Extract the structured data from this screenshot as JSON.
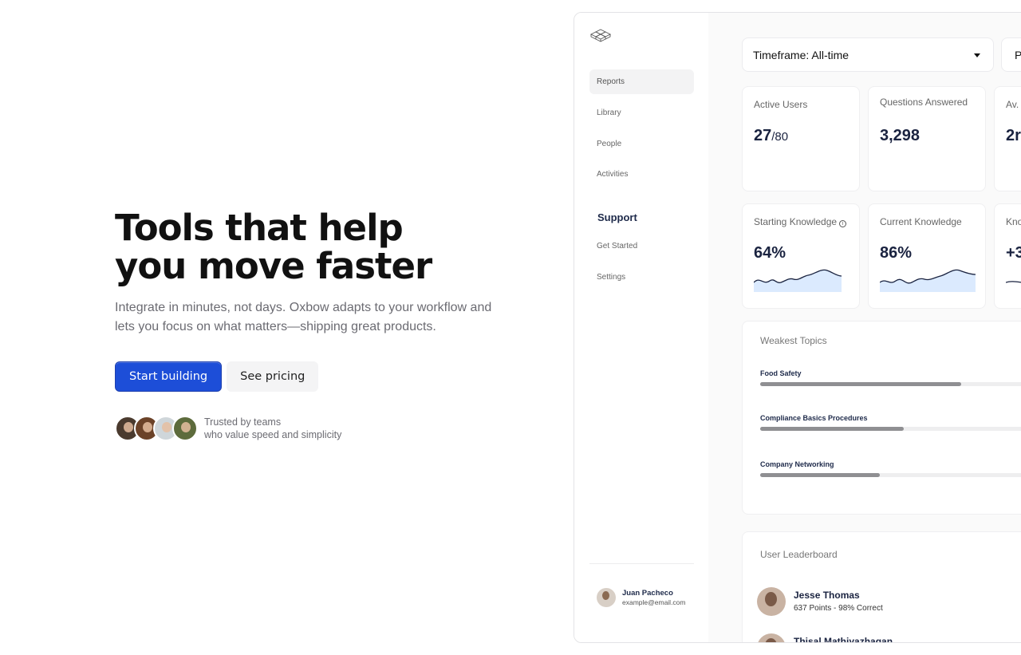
{
  "hero": {
    "title_line1": "Tools that help",
    "title_line2": "you move faster",
    "subtitle": "Integrate in minutes, not days. Oxbow adapts to your workflow and lets you focus on what matters—shipping great products.",
    "primary_cta": "Start building",
    "secondary_cta": "See pricing",
    "trust_line1": "Trusted by teams",
    "trust_line2": "who value speed and simplicity"
  },
  "colors": {
    "primary": "#1d4ed8",
    "navy": "#1a2340",
    "sparkline_fill": "#dbeafe"
  },
  "sidebar": {
    "items": [
      {
        "label": "Reports",
        "active": true
      },
      {
        "label": "Library"
      },
      {
        "label": "People"
      },
      {
        "label": "Activities"
      }
    ],
    "support_heading": "Support",
    "support_items": [
      {
        "label": "Get Started"
      },
      {
        "label": "Settings"
      }
    ],
    "user": {
      "name": "Juan Pacheco",
      "email": "example@email.com"
    }
  },
  "filters": {
    "timeframe": "Timeframe: All-time",
    "second_partial": "P"
  },
  "stats": [
    {
      "label": "Active Users",
      "value": "27",
      "suffix": "/80"
    },
    {
      "label": "Questions Answered",
      "value": "3,298"
    },
    {
      "label": "Av.",
      "value": "2r"
    },
    {
      "label": "Starting Knowledge",
      "value": "64%"
    },
    {
      "label": "Current Knowledge",
      "value": "86%"
    },
    {
      "label": "Kno",
      "value": "+3"
    }
  ],
  "weakest": {
    "title": "Weakest Topics",
    "topics": [
      {
        "name": "Food Safety",
        "progress": 0.74
      },
      {
        "name": "Compliance Basics Procedures",
        "progress": 0.53
      },
      {
        "name": "Company Networking",
        "progress": 0.44
      }
    ]
  },
  "leaderboard": {
    "title": "User Leaderboard",
    "users": [
      {
        "name": "Jesse Thomas",
        "points": "637 Points - 98% Correct"
      },
      {
        "name": "Thisal Mathiyazhagan",
        "points": ""
      }
    ]
  }
}
